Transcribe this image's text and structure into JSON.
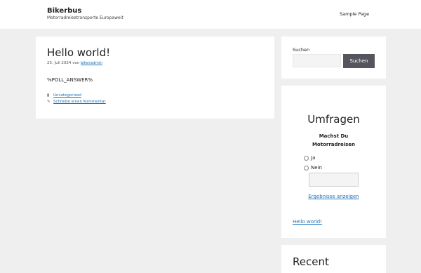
{
  "site": {
    "title": "Bikerbus",
    "tagline": "Motorradreisetransporte Europaweit"
  },
  "nav": {
    "items": [
      {
        "label": "Sample Page"
      }
    ]
  },
  "post": {
    "title": "Hello world!",
    "date": "25. Juli 2024",
    "by": "von",
    "author": "bikeradmin",
    "body": "%POLL_ANSWER%",
    "category": "Uncategorized",
    "comment_link": "Schreibe einen Kommentar",
    "category_icon": "folder-icon",
    "comment_icon": "tag-icon"
  },
  "sidebar": {
    "search": {
      "label": "Suchen",
      "placeholder": "",
      "value": "",
      "button": "Suchen"
    },
    "poll": {
      "heading": "Umfragen",
      "question_line1": "Machst Du",
      "question_line2": "Motorradreisen",
      "options": [
        {
          "label": "Ja",
          "selected": false
        },
        {
          "label": "Nein",
          "selected": false
        }
      ],
      "results_link": "Ergebnisse anzeigen",
      "post_link": "Hello world!"
    },
    "recent": {
      "heading": "Recent"
    }
  },
  "colors": {
    "page_background": "#efefef",
    "card_background": "#ffffff",
    "link": "#1e73be",
    "button": "#55555e",
    "button_text": "#ffffff"
  }
}
